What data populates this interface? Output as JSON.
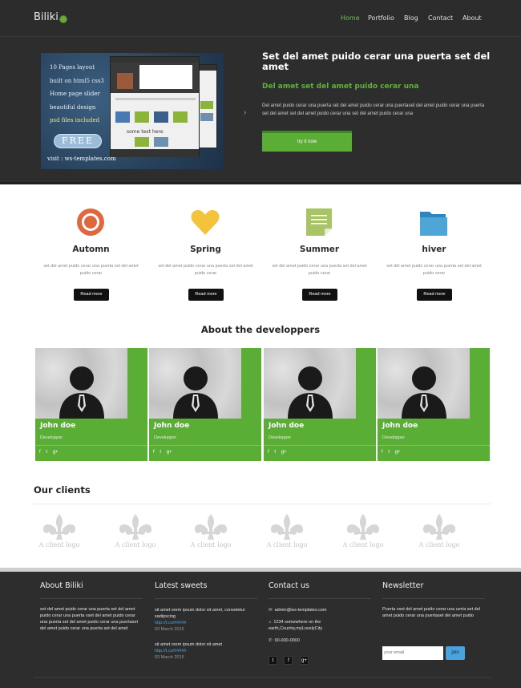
{
  "nav": {
    "logo": "Biliki",
    "links": [
      "Home",
      "Portfolio",
      "Blog",
      "Contact",
      "About"
    ],
    "active": "Home"
  },
  "hero": {
    "promo": {
      "lines": [
        "10 Pages layout",
        "built on html5 css3",
        "Home page slider",
        "beautiful design",
        "psd files included"
      ],
      "badge": "FREE",
      "url": "visit : ws-templates.com",
      "mock_caption": "some text here"
    },
    "title": "Set del amet puido cerar una puerta set del amet",
    "subtitle": "Del amet set del amet puido cerar una",
    "text": "Del amet puido cerar una puerta set del amet puido cerar una puertaset del amet puido cerar una puerta set del amet set del amet puido cerar una set del amet puido cerar una",
    "button": "try it now"
  },
  "features": [
    {
      "icon": "target-icon",
      "title": "Automn",
      "text": "set del amet puido cerar una puerta set del amet puido cerar",
      "button": "Read more",
      "color": "#e0683f"
    },
    {
      "icon": "heart-icon",
      "title": "Spring",
      "text": "set del amet puido cerar una puerta set del amet puido cerar",
      "button": "Read more",
      "color": "#f3c43b"
    },
    {
      "icon": "document-icon",
      "title": "Summer",
      "text": "set del amet puido cerar una puerta set del amet puido cerar",
      "button": "Read more",
      "color": "#a9c466"
    },
    {
      "icon": "folder-icon",
      "title": "hiver",
      "text": "set del amet puido cerar una puerta set del amet puido cerar",
      "button": "Read more",
      "color": "#4ea6d8"
    }
  ],
  "team": {
    "heading": "About the developpers",
    "members": [
      {
        "name": "John doe",
        "role": "Developper"
      },
      {
        "name": "John doe",
        "role": "Developper"
      },
      {
        "name": "John doe",
        "role": "Developper"
      },
      {
        "name": "John doe",
        "role": "Developper"
      }
    ],
    "social": [
      "f",
      "t",
      "g+"
    ]
  },
  "clients": {
    "heading": "Our clients",
    "logos": [
      "A client logo",
      "A client logo",
      "A client logo",
      "A client logo",
      "A client logo",
      "A client logo"
    ]
  },
  "footer": {
    "about": {
      "title": "About Biliki",
      "text": "set del amet puido cerar una puerta set del amet puido cerar una puerta vset del amet puido cerar una puerta set del amet puido cerar una puertaset del amet puido cerar una puerta set del amet"
    },
    "sweets": {
      "title": "Latest sweets",
      "posts": [
        {
          "text": "sit amet orem ipsum dolor sit amet, consetetur sadipscing",
          "link": "http://t.co/#####",
          "date": "03 March 2015"
        },
        {
          "text": "sit amet orem ipsum dolor sit amet",
          "link": "http://t.co/#####",
          "date": "03 March 2015"
        }
      ]
    },
    "contact": {
      "title": "Contact us",
      "email": "admin@ws-templates.com",
      "address": "1234 somewhere on the earth,Country,myLovelyCity",
      "phone": "00-000-0000",
      "social": [
        "t",
        "f",
        "g+"
      ]
    },
    "newsletter": {
      "title": "Newsletter",
      "text": "Puerta vset del amet puido cerar una uerta set del amet puido cerar una puertaset del amet puido",
      "placeholder": "your email",
      "button": "join"
    }
  },
  "colors": {
    "accent": "#5aad35",
    "dark_bg": "#2d2d2d",
    "link": "#4aa3df"
  }
}
